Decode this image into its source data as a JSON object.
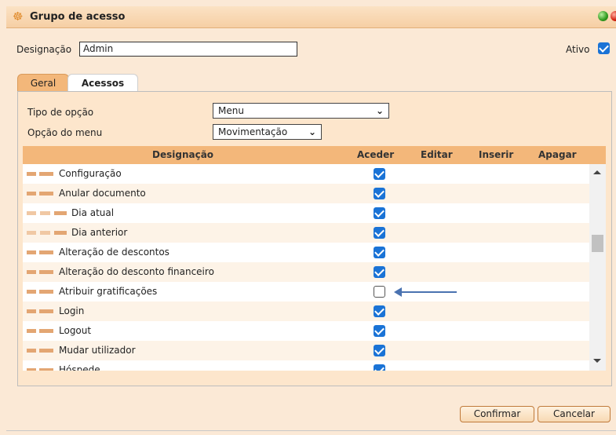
{
  "window": {
    "title": "Grupo de acesso",
    "title_icon": "org-tree-icon",
    "controls": [
      "green-dot",
      "red-dot"
    ]
  },
  "header": {
    "designacao_label": "Designação",
    "designacao_value": "Admin",
    "ativo_label": "Ativo",
    "ativo_checked": true
  },
  "tabs": [
    {
      "label": "Geral",
      "active": false
    },
    {
      "label": "Acessos",
      "active": true
    }
  ],
  "filters": {
    "tipo_label": "Tipo de opção",
    "tipo_value": "Menu",
    "opcao_label": "Opção do menu",
    "opcao_value": "Movimentação"
  },
  "grid": {
    "columns": [
      "Designação",
      "Aceder",
      "Editar",
      "Inserir",
      "Apagar"
    ],
    "rows": [
      {
        "label": "Configuração",
        "level": 2,
        "aceder": true
      },
      {
        "label": "Anular documento",
        "level": 2,
        "aceder": true
      },
      {
        "label": "Dia atual",
        "level": 3,
        "aceder": true
      },
      {
        "label": "Dia anterior",
        "level": 3,
        "aceder": true
      },
      {
        "label": "Alteração de descontos",
        "level": 2,
        "aceder": true
      },
      {
        "label": "Alteração do desconto financeiro",
        "level": 2,
        "aceder": true
      },
      {
        "label": "Atribuir gratificações",
        "level": 2,
        "aceder": false
      },
      {
        "label": "Login",
        "level": 2,
        "aceder": true
      },
      {
        "label": "Logout",
        "level": 2,
        "aceder": true
      },
      {
        "label": "Mudar utilizador",
        "level": 2,
        "aceder": true
      },
      {
        "label": "Hóspede",
        "level": 2,
        "aceder": true
      }
    ]
  },
  "buttons": {
    "confirm": "Confirmar",
    "cancel": "Cancelar"
  },
  "colors": {
    "accent": "#f3b77a",
    "checkbox": "#1a73d6",
    "annotation_arrow": "#4a72b0"
  }
}
